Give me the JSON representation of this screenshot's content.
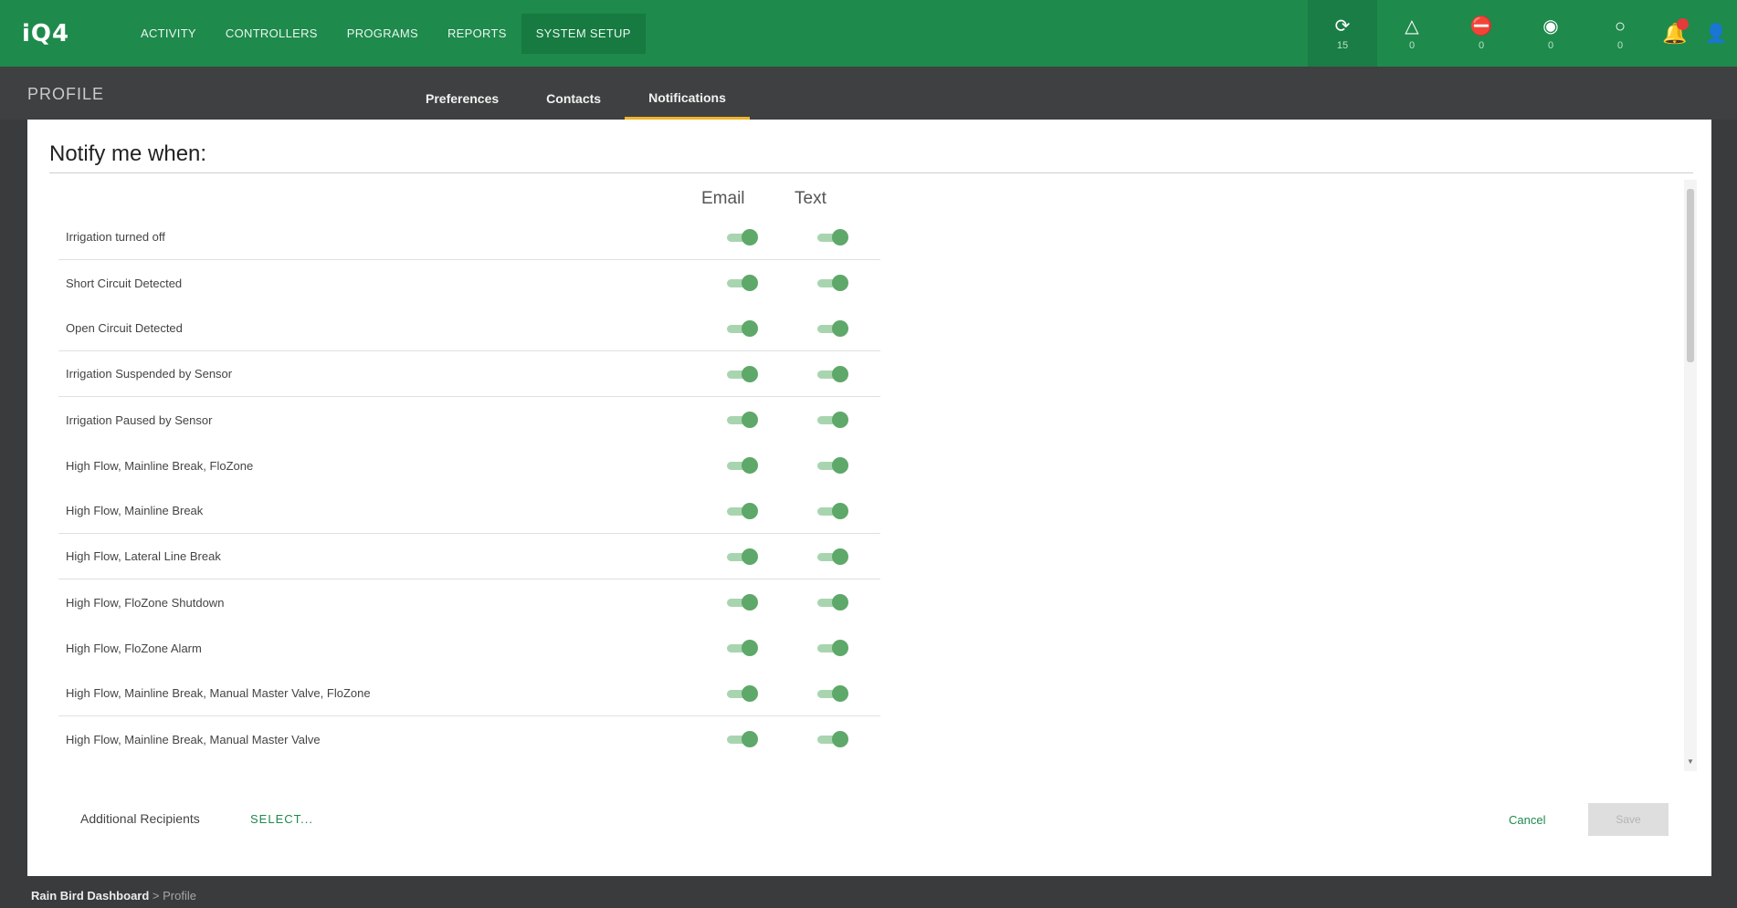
{
  "app": {
    "logo": "iQ4"
  },
  "nav": [
    "ACTIVITY",
    "CONTROLLERS",
    "PROGRAMS",
    "REPORTS",
    "SYSTEM SETUP"
  ],
  "status_icons": [
    {
      "icon": "sync-icon",
      "glyph": "⟳",
      "count": "15"
    },
    {
      "icon": "warning-icon",
      "glyph": "△",
      "count": "0"
    },
    {
      "icon": "lock-icon",
      "glyph": "⛔",
      "count": "0"
    },
    {
      "icon": "target-icon",
      "glyph": "◉",
      "count": "0"
    },
    {
      "icon": "circle-icon",
      "glyph": "○",
      "count": "0"
    }
  ],
  "profile": {
    "title": "PROFILE"
  },
  "tabs": [
    "Preferences",
    "Contacts",
    "Notifications"
  ],
  "active_tab": "Notifications",
  "notify": {
    "title": "Notify me when:",
    "col_email": "Email",
    "col_text": "Text",
    "rows": [
      {
        "label": "Irrigation turned off",
        "email": true,
        "text": true
      },
      {
        "label": "Short Circuit Detected",
        "email": true,
        "text": true
      },
      {
        "label": "Open Circuit Detected",
        "email": true,
        "text": true
      },
      {
        "label": "Irrigation Suspended by Sensor",
        "email": true,
        "text": true
      },
      {
        "label": "Irrigation Paused by Sensor",
        "email": true,
        "text": true
      },
      {
        "label": "High Flow, Mainline Break, FloZone",
        "email": true,
        "text": true
      },
      {
        "label": "High Flow, Mainline Break",
        "email": true,
        "text": true
      },
      {
        "label": "High Flow, Lateral Line Break",
        "email": true,
        "text": true
      },
      {
        "label": "High Flow, FloZone Shutdown",
        "email": true,
        "text": true
      },
      {
        "label": "High Flow, FloZone Alarm",
        "email": true,
        "text": true
      },
      {
        "label": "High Flow, Mainline Break, Manual Master Valve, FloZone",
        "email": true,
        "text": true
      },
      {
        "label": "High Flow, Mainline Break, Manual Master Valve",
        "email": true,
        "text": true
      }
    ]
  },
  "footer": {
    "additional_recipients": "Additional Recipients",
    "select_label": "SELECT...",
    "cancel_label": "Cancel",
    "save_label": "Save"
  },
  "breadcrumb": {
    "root": "Rain Bird Dashboard",
    "separator": ">",
    "current": "Profile"
  },
  "colors": {
    "brand": "#1e8a4c",
    "toggle_on": "#5ea869",
    "tab_active_underline": "#f0b429"
  }
}
